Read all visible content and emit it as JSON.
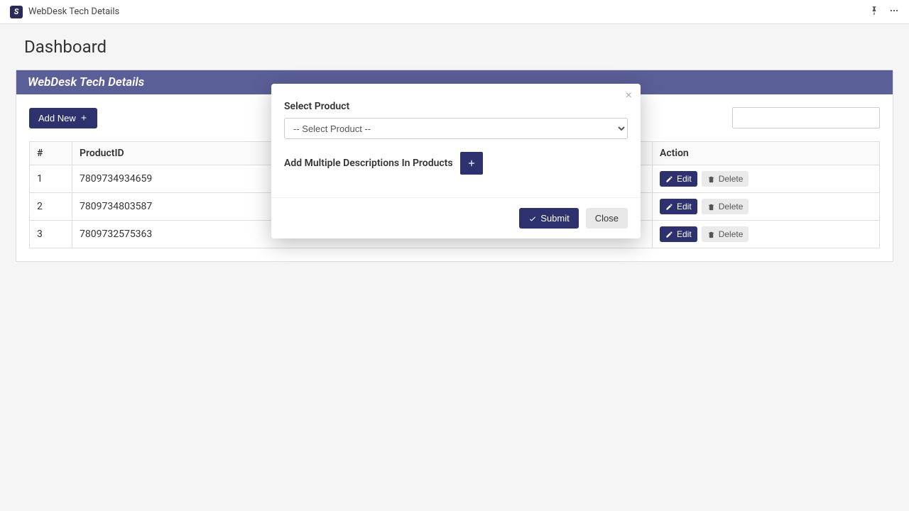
{
  "topbar": {
    "title": "WebDesk Tech Details"
  },
  "page": {
    "title": "Dashboard"
  },
  "panel": {
    "title": "WebDesk Tech Details",
    "add_new": "Add New"
  },
  "search": {
    "placeholder": ""
  },
  "table": {
    "headers": {
      "num": "#",
      "product_id": "ProductID",
      "action": "Action"
    },
    "rows": [
      {
        "num": "1",
        "product_id": "7809734934659"
      },
      {
        "num": "2",
        "product_id": "7809734803587"
      },
      {
        "num": "3",
        "product_id": "7809732575363"
      }
    ],
    "edit": "Edit",
    "delete": "Delete"
  },
  "modal": {
    "select_label": "Select Product",
    "select_placeholder": "-- Select Product --",
    "multi_label": "Add Multiple Descriptions In Products",
    "submit": "Submit",
    "close": "Close"
  }
}
